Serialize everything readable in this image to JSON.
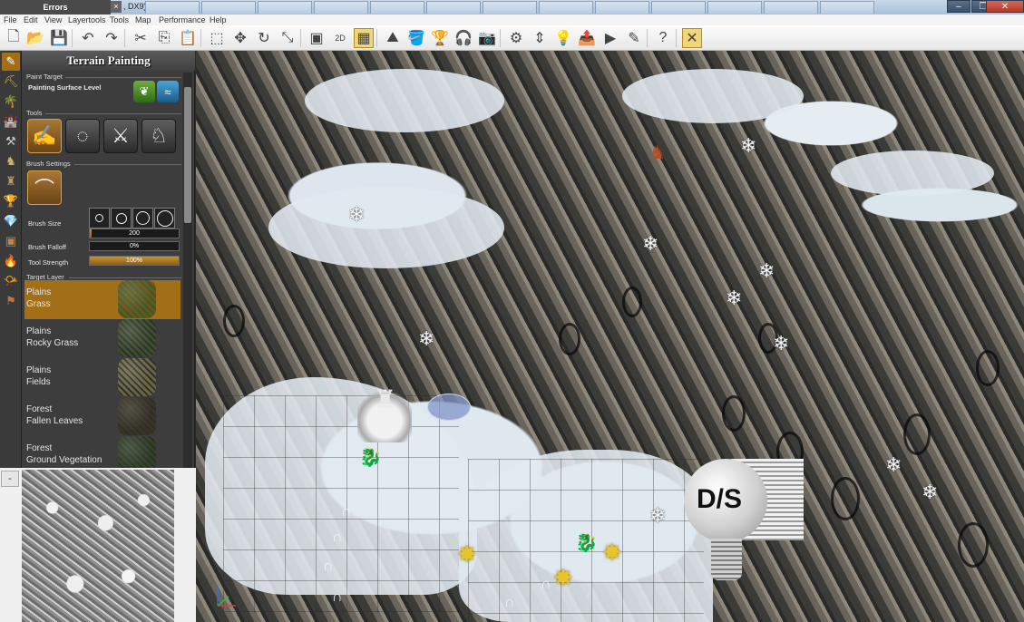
{
  "titlebar": {
    "errors_label": "Errors",
    "renderer_label": ", DX9)",
    "window_buttons": [
      "–",
      "❐",
      "✕"
    ]
  },
  "menu": {
    "items": [
      "File",
      "Edit",
      "View",
      "Layertools",
      "Tools",
      "Map",
      "Performance",
      "Help"
    ]
  },
  "toolbar": {
    "buttons": [
      {
        "name": "new-file-icon",
        "glyph": "🗋"
      },
      {
        "name": "open-folder-icon",
        "glyph": "📂"
      },
      {
        "name": "save-icon",
        "glyph": "💾"
      },
      {
        "name": "undo-icon",
        "glyph": "↶"
      },
      {
        "name": "redo-icon",
        "glyph": "↷"
      },
      {
        "name": "cut-icon",
        "glyph": "✂"
      },
      {
        "name": "copy-icon",
        "glyph": "⎘"
      },
      {
        "name": "paste-icon",
        "glyph": "📋"
      },
      {
        "name": "select-icon",
        "glyph": "⬚"
      },
      {
        "name": "move-icon",
        "glyph": "✥"
      },
      {
        "name": "rotate-icon",
        "glyph": "↻"
      },
      {
        "name": "scale-icon",
        "glyph": "⤡"
      },
      {
        "name": "view-3d-icon",
        "glyph": "▣"
      },
      {
        "name": "view-2d-icon",
        "glyph": "2D"
      },
      {
        "name": "grid-icon",
        "glyph": "▦"
      },
      {
        "name": "terrain-icon",
        "glyph": "⛰"
      },
      {
        "name": "paint-bucket-icon",
        "glyph": "🪣"
      },
      {
        "name": "trophy-icon",
        "glyph": "🏆"
      },
      {
        "name": "headset-icon",
        "glyph": "🎧"
      },
      {
        "name": "camera-icon",
        "glyph": "📷"
      },
      {
        "name": "settings-icon",
        "glyph": "⚙"
      },
      {
        "name": "arrows-icon",
        "glyph": "⇕"
      },
      {
        "name": "lightbulb-icon",
        "glyph": "💡"
      },
      {
        "name": "export-icon",
        "glyph": "📤"
      },
      {
        "name": "play-icon",
        "glyph": "▶"
      },
      {
        "name": "edit-icon",
        "glyph": "✎"
      },
      {
        "name": "help-icon",
        "glyph": "?"
      },
      {
        "name": "tools-active-icon",
        "glyph": "✕"
      }
    ]
  },
  "panel": {
    "title": "Terrain Painting",
    "paint_target_label": "Paint Target",
    "paint_surface_label": "Painting Surface Level",
    "tools_label": "Tools",
    "brush_settings_label": "Brush Settings",
    "brush_size_label": "Brush Size",
    "brush_size_value": "200",
    "brush_falloff_label": "Brush Falloff",
    "brush_falloff_value": "0%",
    "tool_strength_label": "Tool Strength",
    "tool_strength_value": "100%",
    "target_layer_label": "Target Layer",
    "layers": [
      {
        "line1": "Plains",
        "line2": "Grass",
        "color": "#3f5a2a",
        "selected": true
      },
      {
        "line1": "Plains",
        "line2": "Rocky Grass",
        "color": "#3d4f2c",
        "selected": false
      },
      {
        "line1": "Plains",
        "line2": "Fields",
        "color": "#6b6642",
        "selected": false
      },
      {
        "line1": "Forest",
        "line2": "Fallen Leaves",
        "color": "#3a3424",
        "selected": false
      },
      {
        "line1": "Forest",
        "line2": "Ground Vegetation",
        "color": "#2f4421",
        "selected": false
      }
    ]
  },
  "minimap": {
    "toggle_label": "-"
  },
  "logo": {
    "text": "D/S"
  },
  "colors": {
    "accent": "#a26f16",
    "panel_bg": "#3d3d3d"
  }
}
